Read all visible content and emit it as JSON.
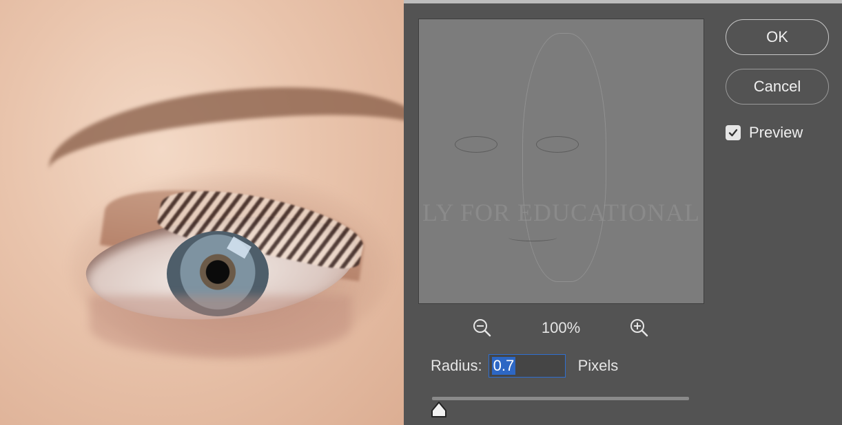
{
  "canvas": {
    "description_icon": "eye-photo"
  },
  "preview": {
    "watermark_text": "LY FOR EDUCATIONAL"
  },
  "zoom": {
    "level": "100%",
    "zoom_out_icon": "zoom-out-icon",
    "zoom_in_icon": "zoom-in-icon"
  },
  "buttons": {
    "ok_label": "OK",
    "cancel_label": "Cancel"
  },
  "preview_toggle": {
    "label": "Preview",
    "checked": true
  },
  "radius": {
    "label": "Radius:",
    "value": "0.7",
    "unit": "Pixels",
    "slider_fraction": 0.01
  },
  "colors": {
    "panel_bg": "#535353",
    "selection": "#2d67c4",
    "input_border": "#2f6fd1"
  }
}
